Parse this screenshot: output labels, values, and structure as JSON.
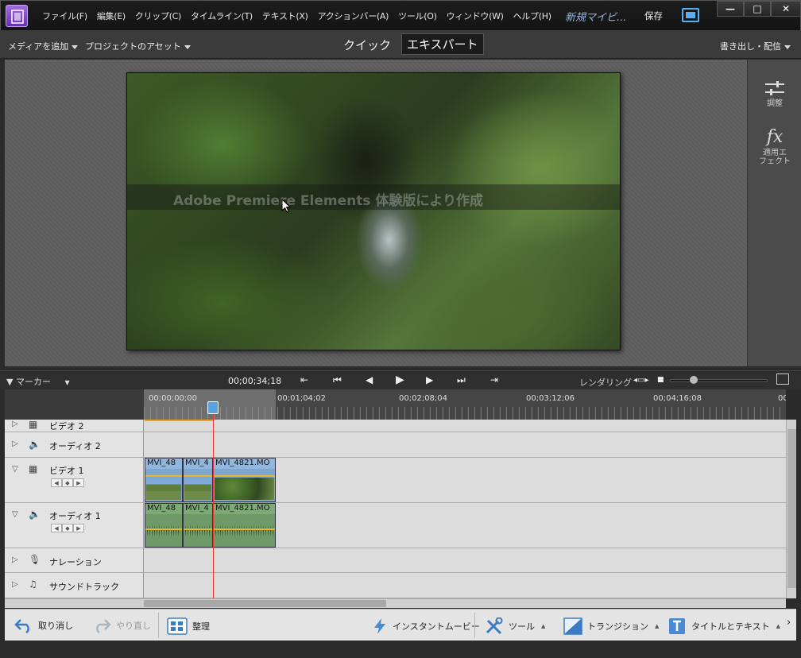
{
  "menubar": {
    "items": [
      "ファイル(F)",
      "編集(E)",
      "クリップ(C)",
      "タイムライン(T)",
      "テキスト(X)",
      "アクションバー(A)",
      "ツール(O)",
      "ウィンドウ(W)",
      "ヘルプ(H)"
    ],
    "project_name": "新規マイビ...",
    "save_label": "保存"
  },
  "subbar": {
    "add_media": "メディアを追加",
    "project_assets": "プロジェクトのアセット",
    "mode_quick": "クイック",
    "mode_expert": "エキスパート",
    "export_share": "書き出し・配信"
  },
  "monitor": {
    "watermark": "Adobe Premiere Elements 体験版により作成"
  },
  "right_panel": {
    "adjust": "調整",
    "applied_effects_line1": "適用エ",
    "applied_effects_line2": "フェクト"
  },
  "timeline_controls": {
    "marker": "マーカー",
    "timecode": "00;00;34;18",
    "render": "レンダリング",
    "zoom_level": 0.22
  },
  "ruler": {
    "timecodes": [
      "00;00;00;00",
      "00;01;04;02",
      "00;02;08;04",
      "00;03;12;06",
      "00;04;16;08",
      "00;0"
    ]
  },
  "tracks": [
    {
      "name": "ビデオ 2",
      "type": "video"
    },
    {
      "name": "オーディオ 2",
      "type": "audio"
    },
    {
      "name": "ビデオ 1",
      "type": "video",
      "clips": [
        "MVI_48",
        "MVI_4",
        "MVI_4821.MO"
      ]
    },
    {
      "name": "オーディオ 1",
      "type": "audio",
      "clips": [
        "MVI_48",
        "MVI_4",
        "MVI_4821.MO"
      ]
    },
    {
      "name": "ナレーション",
      "type": "narration"
    },
    {
      "name": "サウンドトラック",
      "type": "soundtrack"
    }
  ],
  "actionbar": {
    "undo": "取り消し",
    "redo": "やり直し",
    "organize": "整理",
    "instant_movie": "インスタントムービー",
    "tools": "ツール",
    "transitions": "トランジション",
    "titles_text": "タイトルとテキスト"
  },
  "colors": {
    "accent_blue": "#5aa2e0",
    "playhead_red": "#ee3333",
    "video_clip": "#8fb7e0",
    "audio_clip": "#7eaa76"
  }
}
